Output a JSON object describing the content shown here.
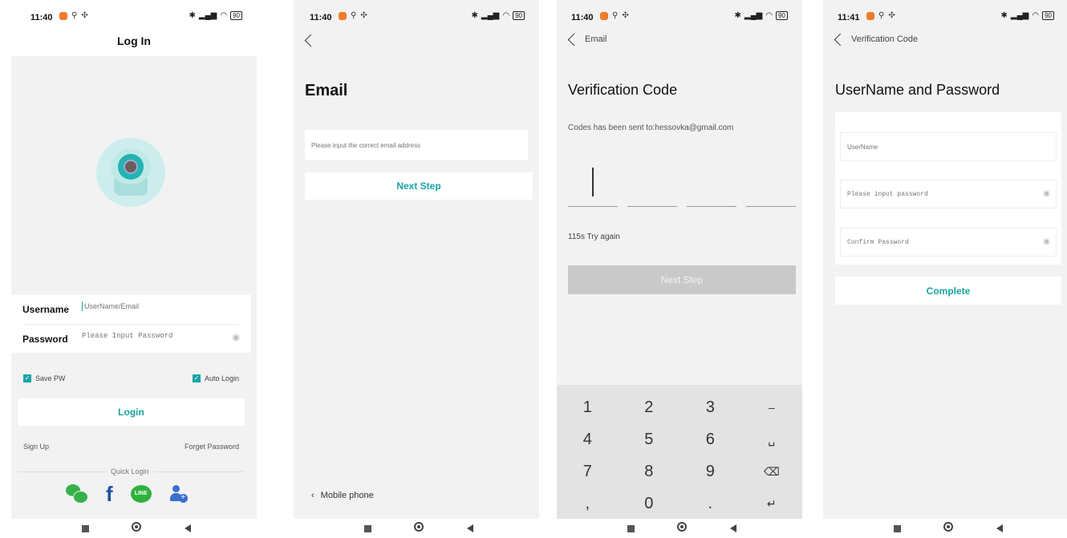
{
  "status_bars": [
    {
      "time": "11:40",
      "battery": "90"
    },
    {
      "time": "11:40",
      "battery": "90"
    },
    {
      "time": "11:40",
      "battery": "90"
    },
    {
      "time": "11:41",
      "battery": "90"
    }
  ],
  "login": {
    "title": "Log In",
    "username_label": "Username",
    "username_placeholder": "UserName/Email",
    "password_label": "Password",
    "password_placeholder": "Please Input Password",
    "save_pw_label": "Save PW",
    "auto_login_label": "Auto Login",
    "login_button": "Login",
    "sign_up": "Sign Up",
    "forget_password": "Forget Password",
    "quick_login": "Quick Login",
    "social": [
      "wechat-icon",
      "facebook-icon",
      "line-icon",
      "add-contact-icon"
    ],
    "line_text": "LINE"
  },
  "email": {
    "title": "Email",
    "email_placeholder": "Please input the correct email address",
    "next_button": "Next Step",
    "mobile_link": "Mobile phone"
  },
  "verify": {
    "back_label": "Email",
    "title": "Verification Code",
    "sent_to": "Codes has been sent to:hessovka@gmail.com",
    "retry": "115s Try again",
    "next_button": "Next Step",
    "keypad": [
      [
        "1",
        "2",
        "3",
        "–"
      ],
      [
        "4",
        "5",
        "6",
        "␣"
      ],
      [
        "7",
        "8",
        "9",
        "⌫"
      ],
      [
        ",",
        "0",
        ".",
        "↵"
      ]
    ]
  },
  "userpass": {
    "back_label": "Verification Code",
    "title": "UserName and Password",
    "username_placeholder": "UserName",
    "password_placeholder": "Please input password",
    "confirm_placeholder": "Confirm Password",
    "complete_button": "Complete"
  },
  "colors": {
    "accent": "#1aa3a3",
    "checkbox": "#1aa3a3",
    "disabled_button": "#c9c9c9"
  }
}
